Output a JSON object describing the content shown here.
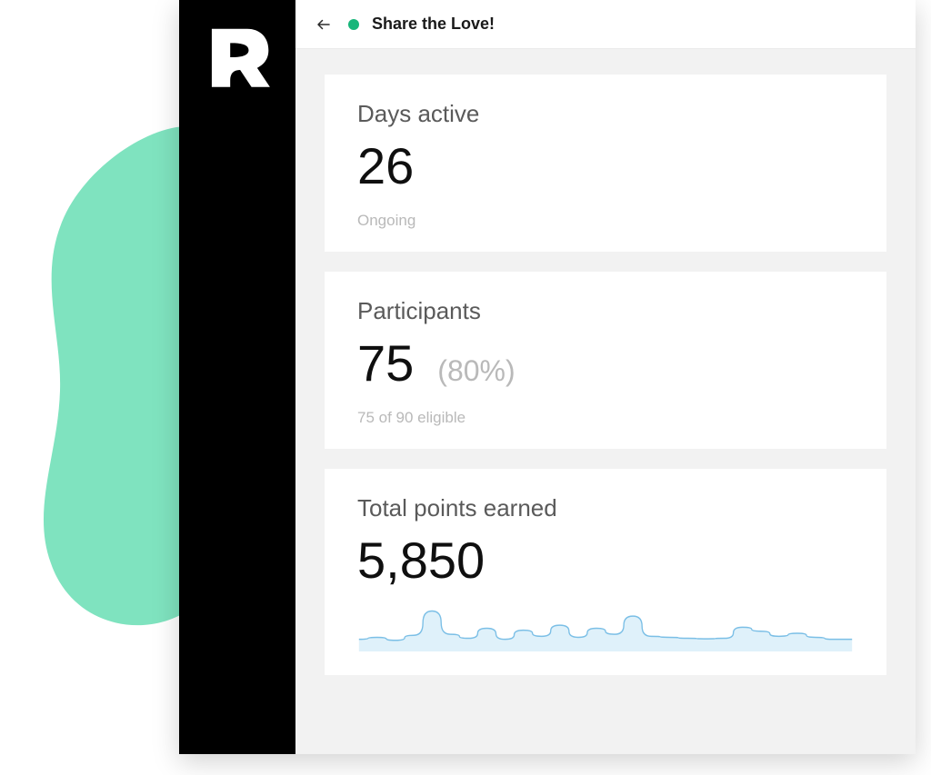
{
  "header": {
    "title": "Share the Love!",
    "status_color": "#18b67a"
  },
  "cards": {
    "days_active": {
      "label": "Days active",
      "value": "26",
      "footnote": "Ongoing"
    },
    "participants": {
      "label": "Participants",
      "value": "75",
      "percent": "(80%)",
      "footnote": "75 of 90 eligible"
    },
    "points": {
      "label": "Total points earned",
      "value": "5,850"
    }
  },
  "colors": {
    "blob": "#7fe3bf",
    "sparkline_stroke": "#7bbfe6",
    "sparkline_fill": "#c9e7f6"
  },
  "chart_data": {
    "type": "line",
    "title": "Total points earned sparkline",
    "values": [
      120,
      140,
      110,
      160,
      400,
      170,
      130,
      230,
      120,
      210,
      150,
      260,
      140,
      230,
      170,
      350,
      150,
      140,
      130,
      125,
      130,
      240,
      200,
      150,
      180,
      140,
      120,
      120
    ],
    "ylim": [
      0,
      450
    ]
  }
}
